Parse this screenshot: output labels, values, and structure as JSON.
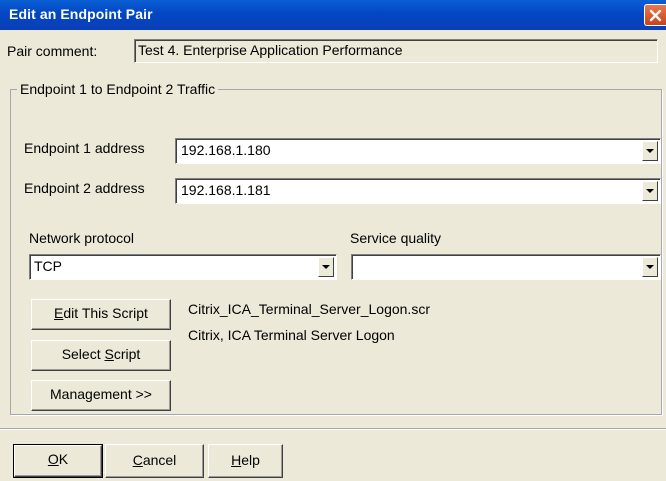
{
  "window": {
    "title": "Edit an Endpoint Pair"
  },
  "pair_comment": {
    "label": "Pair comment:",
    "value": "Test 4. Enterprise Application Performance"
  },
  "traffic_group": {
    "title": "Endpoint 1 to Endpoint 2 Traffic",
    "endpoint1": {
      "label": "Endpoint 1 address",
      "value": "192.168.1.180"
    },
    "endpoint2": {
      "label": "Endpoint 2 address",
      "value": "192.168.1.181"
    },
    "network_protocol": {
      "label": "Network protocol",
      "value": "TCP"
    },
    "service_quality": {
      "label": "Service quality",
      "value": ""
    }
  },
  "script": {
    "edit_button": {
      "mnemonic": "E",
      "rest": "dit This Script"
    },
    "select_button": {
      "prefix": "Select ",
      "mnemonic": "S",
      "rest": "cript"
    },
    "management_button": "Management >>",
    "file_name": "Citrix_ICA_Terminal_Server_Logon.scr",
    "description": "Citrix, ICA Terminal Server Logon"
  },
  "footer": {
    "ok": {
      "mnemonic": "O",
      "rest": "K"
    },
    "cancel": {
      "mnemonic": "C",
      "rest": "ancel"
    },
    "help": {
      "mnemonic": "H",
      "rest": "elp"
    }
  },
  "icons": {
    "close": "close-icon",
    "dropdown": "chevron-down-icon"
  },
  "colors": {
    "titlebar": "#0346c4",
    "dialog_bg": "#ece9d8",
    "close_button": "#d9572a"
  }
}
